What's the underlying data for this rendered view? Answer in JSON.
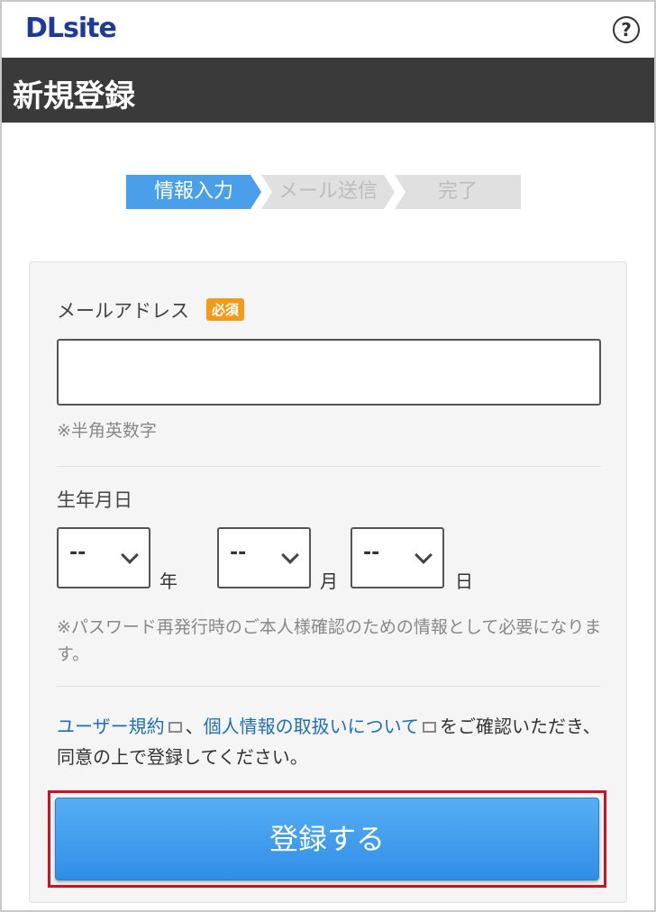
{
  "header": {
    "logo": "DLsite",
    "help_icon": "question-circle-icon"
  },
  "page": {
    "title": "新規登録"
  },
  "steps": [
    {
      "label": "情報入力",
      "state": "active"
    },
    {
      "label": "メール送信",
      "state": "inactive"
    },
    {
      "label": "完了",
      "state": "inactive"
    }
  ],
  "form": {
    "email": {
      "label": "メールアドレス",
      "required_badge": "必須",
      "value": "",
      "hint": "※半角英数字"
    },
    "birthdate": {
      "label": "生年月日",
      "year_value": "--",
      "year_unit": "年",
      "month_value": "--",
      "month_unit": "月",
      "day_value": "--",
      "day_unit": "日",
      "hint": "※パスワード再発行時のご本人様確認のための情報として必要になります。"
    },
    "terms": {
      "link_terms": "ユーザー規約",
      "separator": "、",
      "link_privacy": "個人情報の取扱いについて",
      "text": "をご確認いただき、同意の上で登録してください。"
    },
    "submit_label": "登録する"
  },
  "colors": {
    "accent": "#4a9fea",
    "badge": "#f39a1b",
    "highlight_border": "#d0101a",
    "titlebar": "#3a3a3a",
    "logo": "#1d3a99"
  }
}
